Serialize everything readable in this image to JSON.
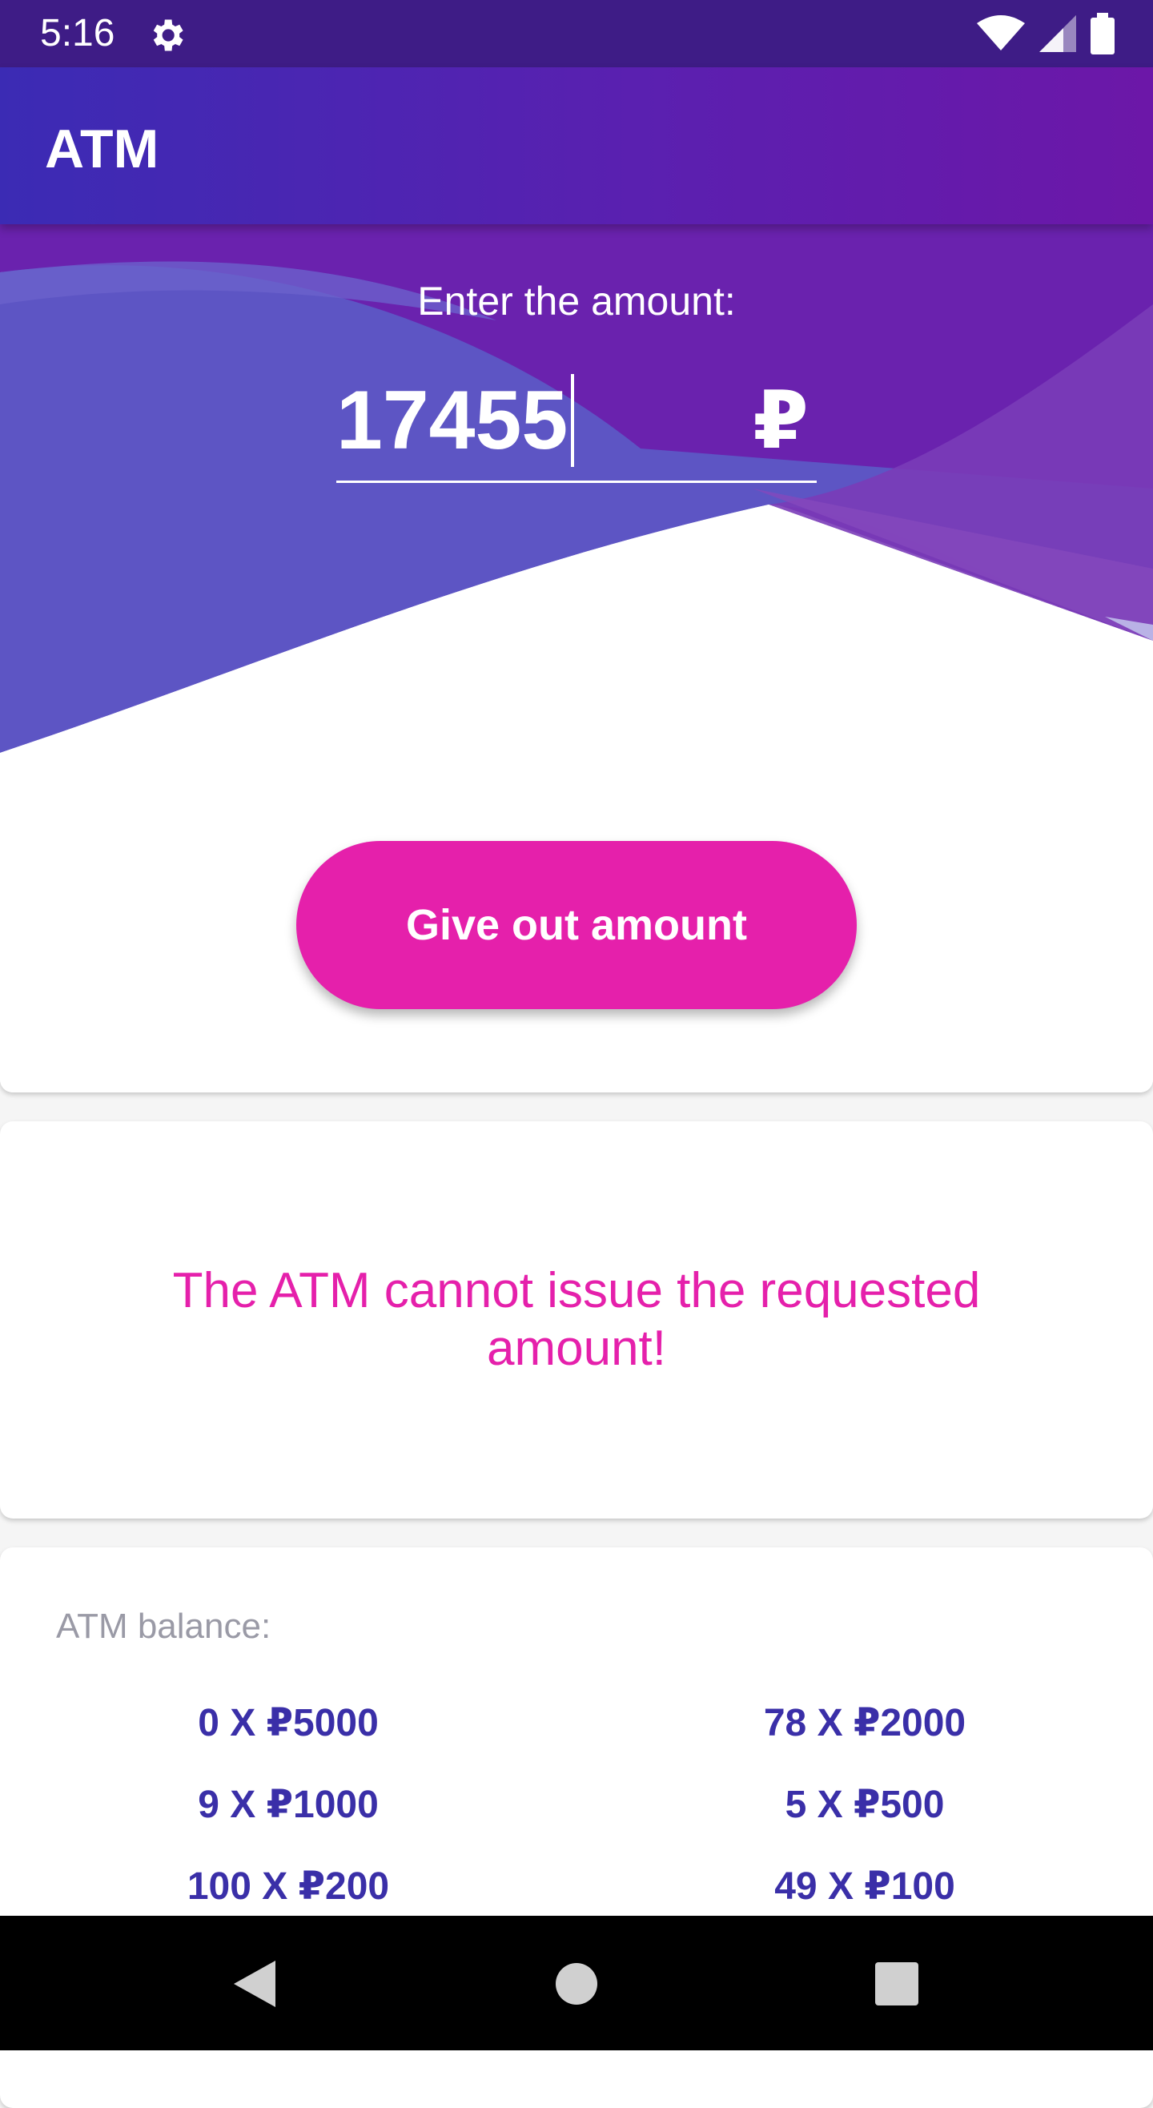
{
  "status_bar": {
    "time": "5:16",
    "icons": [
      "gear-icon",
      "wifi-icon",
      "signal-icon",
      "battery-icon"
    ]
  },
  "app_bar": {
    "title": "ATM"
  },
  "amount_input": {
    "label": "Enter the amount:",
    "value": "17455",
    "currency_symbol": "₽"
  },
  "give_button": {
    "label": "Give out amount"
  },
  "message": {
    "text": "The ATM cannot issue the requested amount!"
  },
  "balance": {
    "label": "ATM balance:",
    "items": [
      {
        "text": "0 X ₽5000"
      },
      {
        "text": "78 X ₽2000"
      },
      {
        "text": "9 X ₽1000"
      },
      {
        "text": "5 X ₽500"
      },
      {
        "text": "100 X ₽200"
      },
      {
        "text": "49 X ₽100"
      }
    ]
  },
  "nav_bar": {
    "buttons": [
      "back-icon",
      "home-icon",
      "recents-icon"
    ]
  },
  "colors": {
    "status_bar": "#3e1c86",
    "app_bar_start": "#3b2bb4",
    "app_bar_end": "#6c17a8",
    "accent_pink": "#e520ab",
    "balance_text": "#3a2fa8",
    "label_gray": "#9a9aa6"
  }
}
